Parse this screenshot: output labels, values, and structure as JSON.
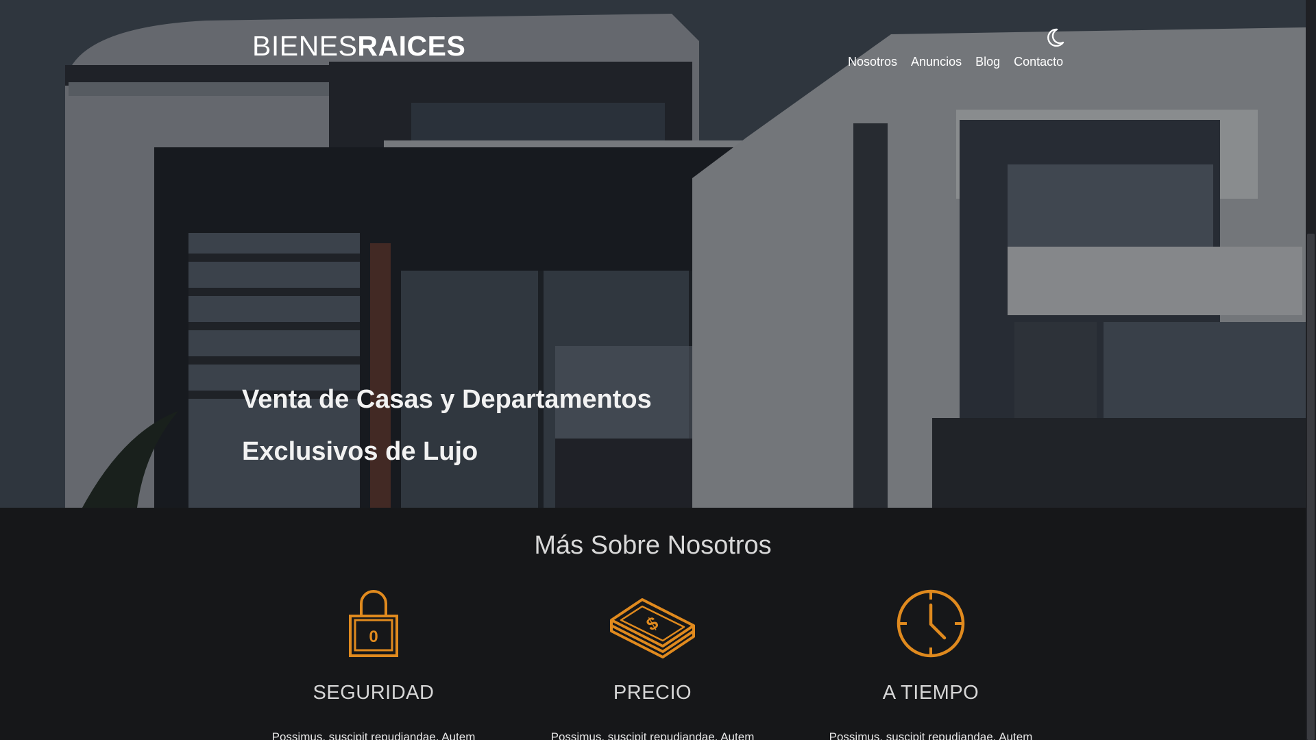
{
  "header": {
    "logo_light": "BIENES",
    "logo_bold": "RAICES",
    "nav": [
      "Nosotros",
      "Anuncios",
      "Blog",
      "Contacto"
    ],
    "theme_toggle_icon": "moon-icon"
  },
  "hero": {
    "title_line1": "Venta de Casas y Departamentos",
    "title_line2": "Exclusivos de Lujo"
  },
  "about": {
    "title": "Más Sobre Nosotros",
    "features": [
      {
        "icon": "lock-icon",
        "title": "SEGURIDAD",
        "text": "Possimus, suscipit repudiandae. Autem"
      },
      {
        "icon": "money-icon",
        "title": "PRECIO",
        "text": "Possimus, suscipit repudiandae. Autem"
      },
      {
        "icon": "clock-icon",
        "title": "A TIEMPO",
        "text": "Possimus, suscipit repudiandae. Autem"
      }
    ]
  },
  "colors": {
    "accent": "#e08a1e",
    "background": "#161719",
    "text": "#ffffff"
  }
}
